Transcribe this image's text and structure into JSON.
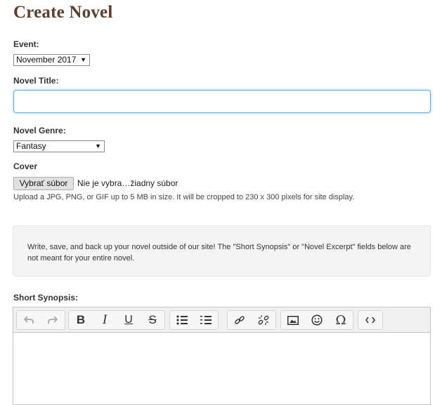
{
  "page": {
    "title": "Create Novel"
  },
  "form": {
    "event_label": "Event:",
    "event_value": "November 2017",
    "title_label": "Novel Title:",
    "title_value": "",
    "genre_label": "Novel Genre:",
    "genre_value": "Fantasy",
    "cover_label": "Cover",
    "file_button": "Vybrať súbor",
    "file_status": "Nie je vybra…žiadny súbor",
    "cover_help": "Upload a JPG, PNG, or GIF up to 5 MB in size. It will be cropped to 230 x 300 pixels for site display.",
    "notice": "Write, save, and back up your novel outside of our site! The \"Short Synopsis\" or \"Novel Excerpt\" fields below are not meant for your entire novel.",
    "synopsis_label": "Short Synopsis:"
  },
  "editor": {
    "toolbar": [
      [
        "undo-icon",
        "redo-icon"
      ],
      [
        "bold-icon",
        "italic-icon",
        "underline-icon",
        "strikethrough-icon"
      ],
      [
        "bullet-list-icon",
        "numbered-list-icon"
      ],
      [
        "link-icon",
        "unlink-icon"
      ],
      [
        "image-icon",
        "emoji-icon",
        "special-character-icon"
      ],
      [
        "source-code-icon"
      ]
    ],
    "content": ""
  }
}
